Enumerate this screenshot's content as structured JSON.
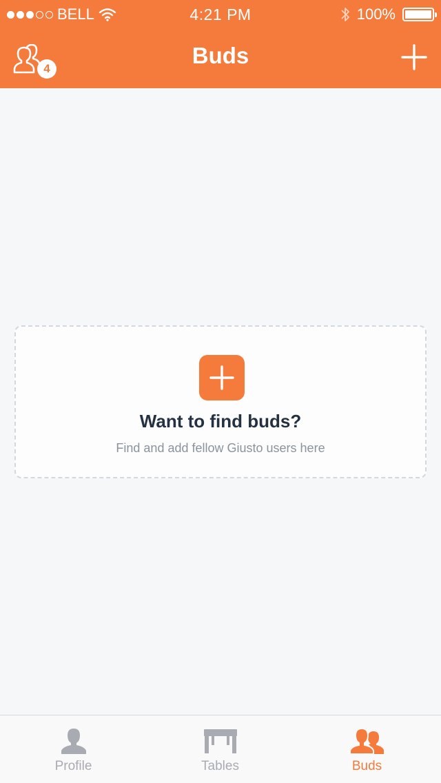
{
  "status_bar": {
    "carrier": "BELL",
    "time": "4:21 PM",
    "battery": "100%",
    "signal_strength": 3,
    "signal_max": 5
  },
  "nav": {
    "title": "Buds",
    "badge_count": "4",
    "left_icon": "friend-requests-icon",
    "right_icon": "plus-icon"
  },
  "empty_state": {
    "title": "Want to find buds?",
    "subtitle": "Find and add fellow Giusto users here",
    "icon": "plus-icon"
  },
  "tabs": [
    {
      "label": "Profile",
      "icon": "person-icon",
      "active": false
    },
    {
      "label": "Tables",
      "icon": "table-icon",
      "active": false
    },
    {
      "label": "Buds",
      "icon": "buds-icon",
      "active": true
    }
  ],
  "colors": {
    "accent": "#f47b3b",
    "background": "#f6f7f9",
    "title_text": "#243140",
    "muted_text": "#8a939c",
    "inactive_tab": "#a8acb2"
  }
}
